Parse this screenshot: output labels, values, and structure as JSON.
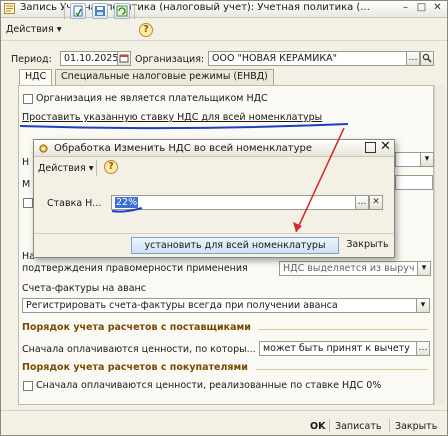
{
  "window": {
    "title": "Запись Учетная политика (налоговый учет): Учетная политика (...",
    "minimize": "–",
    "maximize": "□",
    "close": "✕"
  },
  "toolbar": {
    "actions_label": "Действия",
    "arrow": "▾",
    "help": "?"
  },
  "period": {
    "label": "Период:",
    "value": "01.10.2025"
  },
  "organization": {
    "label": "Организация:",
    "value": "ООО \"НОВАЯ КЕРАМИКА\""
  },
  "tabs": [
    {
      "label": "НДС"
    },
    {
      "label": "Специальные налоговые режимы (ЕНВД)"
    }
  ],
  "vat_tab": {
    "not_payer_label": "Организация не является плательщиком НДС",
    "set_rate_link": "Проставить указанную ставку НДС для всей номенклатуры",
    "obscured_partial": "Н",
    "obscured_partial2": "М",
    "partial_label_left": "На",
    "confirmation_label": "подтверждения правомерности применения",
    "vat_allocated_value": "НДС выделяется из выруч",
    "advance_invoices_label": "Счета-фактуры на аванс",
    "advance_invoices_value": "Регистрировать счета-фактуры всегда при получении аванса",
    "suppliers_section": "Порядок учета расчетов с поставщиками",
    "suppliers_label": "Сначала оплачиваются ценности, по которы...",
    "suppliers_value": "может быть принят к вычету",
    "buyers_section": "Порядок учета расчетов с покупателями",
    "buyers_label": "Сначала оплачиваются ценности, реализованные по ставке НДС 0%"
  },
  "footer": {
    "ok": "OK",
    "save": "Записать",
    "close": "Закрыть"
  },
  "dialog": {
    "title": "Обработка  Изменить НДС во всей номенклатуре",
    "actions_label": "Действия",
    "rate_label": "Ставка Н...",
    "rate_value": "22%",
    "apply_button": "установить для всей номенклатуры",
    "close_button": "Закрыть"
  },
  "colors": {
    "annotation_blue": "#1f3fbf",
    "annotation_red": "#d42a2a",
    "section_brown": "#7a4a00"
  }
}
